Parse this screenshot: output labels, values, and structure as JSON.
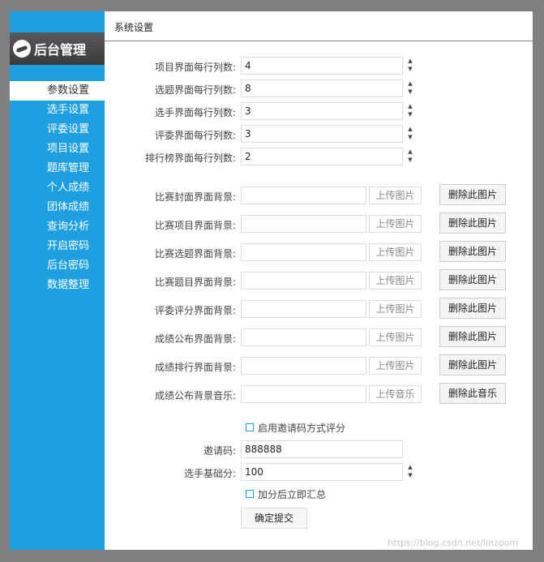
{
  "sidebar": {
    "logo_text": "后台管理",
    "items": [
      {
        "label": "参数设置",
        "active": true
      },
      {
        "label": "选手设置"
      },
      {
        "label": "评委设置"
      },
      {
        "label": "项目设置"
      },
      {
        "label": "题库管理"
      },
      {
        "label": "个人成绩"
      },
      {
        "label": "团体成绩"
      },
      {
        "label": "查询分析"
      },
      {
        "label": "开启密码"
      },
      {
        "label": "后台密码"
      },
      {
        "label": "数据整理"
      }
    ]
  },
  "header": {
    "title": "系统设置"
  },
  "columns": [
    {
      "label": "项目界面每行列数:",
      "value": "4"
    },
    {
      "label": "选题界面每行列数:",
      "value": "8"
    },
    {
      "label": "选手界面每行列数:",
      "value": "3"
    },
    {
      "label": "评委界面每行列数:",
      "value": "3"
    },
    {
      "label": "排行榜界面每行列数:",
      "value": "2"
    }
  ],
  "backgrounds": [
    {
      "label": "比赛封面界面背景:",
      "upload": "上传图片",
      "delete": "删除此图片"
    },
    {
      "label": "比赛项目界面背景:",
      "upload": "上传图片",
      "delete": "删除此图片"
    },
    {
      "label": "比赛选题界面背景:",
      "upload": "上传图片",
      "delete": "删除此图片"
    },
    {
      "label": "比赛题目界面背景:",
      "upload": "上传图片",
      "delete": "删除此图片"
    },
    {
      "label": "评委评分界面背景:",
      "upload": "上传图片",
      "delete": "删除此图片"
    },
    {
      "label": "成绩公布界面背景:",
      "upload": "上传图片",
      "delete": "删除此图片"
    },
    {
      "label": "成绩排行界面背景:",
      "upload": "上传图片",
      "delete": "删除此图片"
    },
    {
      "label": "成绩公布背景音乐:",
      "upload": "上传音乐",
      "delete": "删除此音乐"
    }
  ],
  "invite_checkbox": {
    "label": "启用邀请码方式评分"
  },
  "invite_code": {
    "label": "邀请码:",
    "value": "888888"
  },
  "base_score": {
    "label": "选手基础分:",
    "value": "100"
  },
  "summary_checkbox": {
    "label": "加分后立即汇总"
  },
  "submit": {
    "label": "确定提交"
  },
  "watermark": "https://blog.csdn.net/linzoom",
  "colors": {
    "sidebar": "#1e9fe0",
    "accent": "#1e9fe0"
  }
}
